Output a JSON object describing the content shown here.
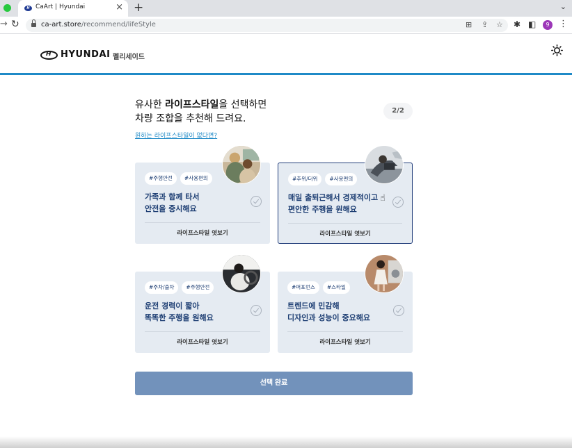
{
  "browser": {
    "tab_title": "CaArt | Hyundai",
    "favicon": "H",
    "url_host": "ca-art.store",
    "url_path": "/recommend/lifeStyle",
    "profile_initial": "9"
  },
  "header": {
    "brand": "HYUNDAI",
    "model": "펠리세이드"
  },
  "intro": {
    "line1_prefix": "유사한 ",
    "line1_bold": "라이프스타일",
    "line1_suffix": "을 선택하면",
    "line2": "차량 조합을 추천해 드려요.",
    "step": "2/2",
    "help_link": "원하는 라이프스타일이 없다면?"
  },
  "cards": [
    {
      "tags": [
        "#주행안전",
        "#사용편의"
      ],
      "title_line1": "가족과 함께 타서",
      "title_line2": "안전을 중시해요",
      "view_label": "라이프스타일 엿보기",
      "selected": false
    },
    {
      "tags": [
        "#추위/더위",
        "#사용편의"
      ],
      "title_line1": "매일 출퇴근해서 경제적이고",
      "title_line2": "편안한 주행을 원해요",
      "view_label": "라이프스타일 엿보기",
      "selected": true
    },
    {
      "tags": [
        "#주차/출차",
        "#주행안전"
      ],
      "title_line1": "운전 경력이 짧아",
      "title_line2": "똑똑한 주행을 원해요",
      "view_label": "라이프스타일 엿보기",
      "selected": false
    },
    {
      "tags": [
        "#퍼포먼스",
        "#스타일"
      ],
      "title_line1": "트렌드에 민감해",
      "title_line2": "디자인과 성능이 중요해요",
      "view_label": "라이프스타일 엿보기",
      "selected": false
    }
  ],
  "submit_label": "선택 완료",
  "colors": {
    "accent": "#1f8ac7",
    "card_bg": "#e5ebf2",
    "navy_text": "#1d3e73",
    "submit_bg": "#7292bb"
  }
}
